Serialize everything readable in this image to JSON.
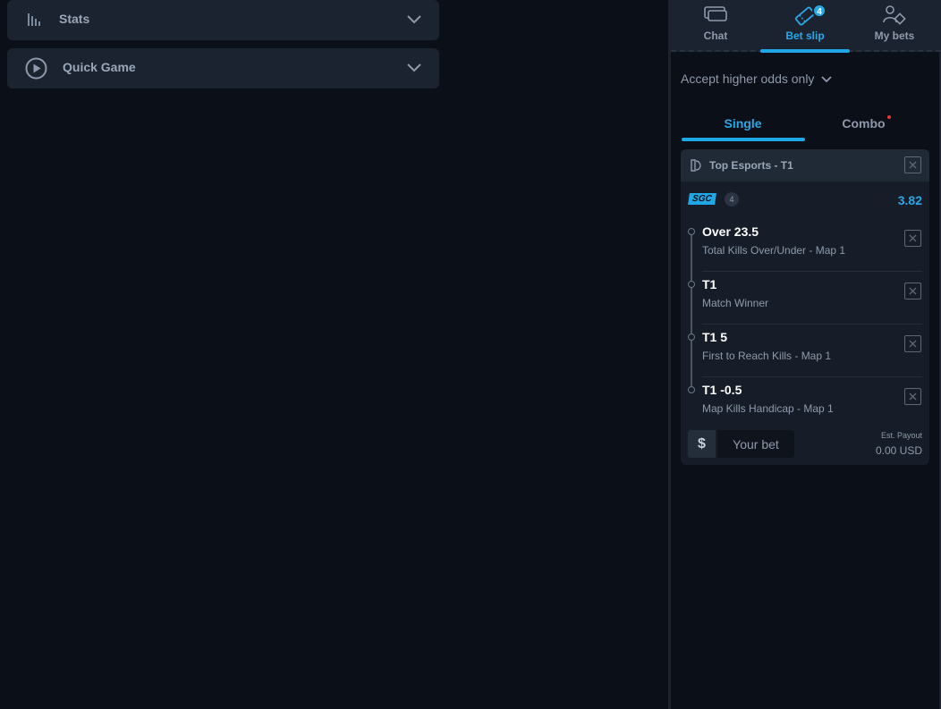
{
  "left": {
    "accordions": [
      {
        "label": "Stats",
        "icon": "stats-bars-icon"
      },
      {
        "label": "Quick Game",
        "icon": "play-circle-icon"
      }
    ]
  },
  "panel": {
    "tabs": [
      {
        "label": "Chat",
        "icon": "chat-icon"
      },
      {
        "label": "Bet slip",
        "icon": "ticket-icon",
        "badge": "4",
        "active": true
      },
      {
        "label": "My bets",
        "icon": "user-ticket-icon"
      }
    ],
    "accept_odds": "Accept higher odds only",
    "modes": {
      "single": "Single",
      "combo": "Combo"
    },
    "card": {
      "title": "Top Esports - T1",
      "sgc_label": "SGC",
      "legs_count": "4",
      "odds": "3.82",
      "legs": [
        {
          "name": "Over 23.5",
          "market": "Total Kills Over/Under - Map 1"
        },
        {
          "name": "T1",
          "market": "Match Winner"
        },
        {
          "name": "T1 5",
          "market": "First to Reach Kills - Map 1"
        },
        {
          "name": "T1 -0.5",
          "market": "Map Kills Handicap - Map 1"
        }
      ],
      "currency_symbol": "$",
      "bet_placeholder": "Your bet",
      "payout_label": "Est. Payout",
      "payout_value": "0.00 USD"
    }
  },
  "colors": {
    "accent": "#29a8e8",
    "bg": "#0b0f17",
    "surface": "#1b2330",
    "notify": "#e53935"
  }
}
